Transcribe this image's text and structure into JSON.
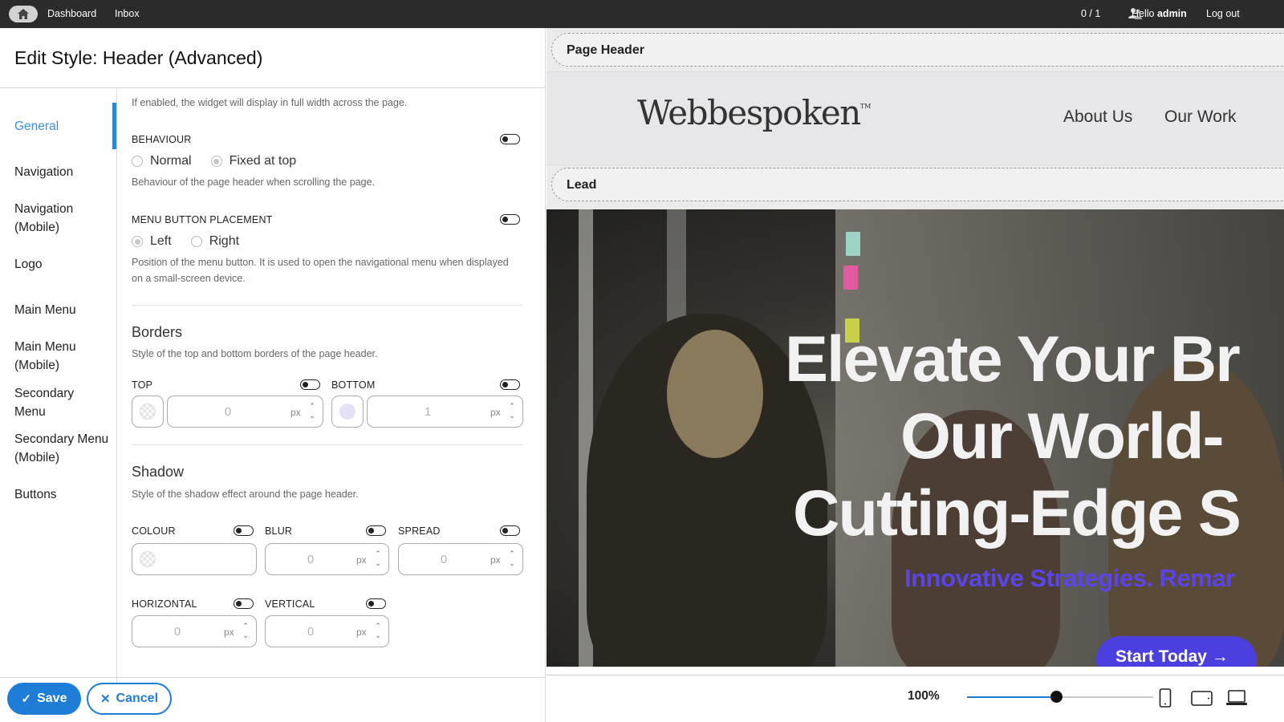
{
  "topbar": {
    "home_icon": "home-icon",
    "dashboard": "Dashboard",
    "inbox": "Inbox",
    "user_count": "0 / 1",
    "users_icon": "users-icon",
    "hello": "Hello",
    "username": "admin",
    "logout": "Log out"
  },
  "editor": {
    "title": "Edit Style: Header (Advanced)",
    "nav": [
      {
        "label": "General"
      },
      {
        "label": "Navigation"
      },
      {
        "label": "Navigation (Mobile)"
      },
      {
        "label": "Logo"
      },
      {
        "label": "Main Menu"
      },
      {
        "label": "Main Menu (Mobile)"
      },
      {
        "label": "Secondary Menu"
      },
      {
        "label": "Secondary Menu (Mobile)"
      },
      {
        "label": "Buttons"
      }
    ],
    "active_nav": "General",
    "full_width_desc": "If enabled, the widget will display in full width across the page.",
    "behaviour": {
      "label": "BEHAVIOUR",
      "options": [
        "Normal",
        "Fixed at top"
      ],
      "selected": "Fixed at top",
      "desc": "Behaviour of the page header when scrolling the page."
    },
    "menu_button": {
      "label": "MENU BUTTON PLACEMENT",
      "options": [
        "Left",
        "Right"
      ],
      "selected": "Left",
      "desc": "Position of the menu button. It is used to open the navigational menu when displayed on a small-screen device."
    },
    "borders": {
      "title": "Borders",
      "desc": "Style of the top and bottom borders of the page header.",
      "top_label": "TOP",
      "top_value": "0",
      "bottom_label": "BOTTOM",
      "bottom_value": "1",
      "unit": "px",
      "bottom_color": "#e3e2f7"
    },
    "shadow": {
      "title": "Shadow",
      "desc": "Style of the shadow effect around the page header.",
      "colour_label": "COLOUR",
      "blur_label": "BLUR",
      "blur_value": "0",
      "spread_label": "SPREAD",
      "spread_value": "0",
      "horizontal_label": "HORIZONTAL",
      "horizontal_value": "0",
      "vertical_label": "VERTICAL",
      "vertical_value": "0",
      "unit": "px"
    },
    "save": "Save",
    "cancel": "Cancel",
    "accent": "#1e7dd6"
  },
  "preview": {
    "page_header_label": "Page Header",
    "lead_label": "Lead",
    "logo_text": "Webbespoken",
    "logo_tm": "TM",
    "menu": [
      "About Us",
      "Our Work"
    ],
    "hero_lines": [
      "Elevate Your Br",
      "Our World-",
      "Cutting-Edge S"
    ],
    "hero_sub": "Innovative Strategies. Remar",
    "cta": "Start Today →",
    "cta_color": "#4b3fe0",
    "sub_color": "#5b45e8",
    "zoom": "100%",
    "zoom_fraction": 0.48,
    "devices": [
      "phone-icon",
      "tablet-icon",
      "laptop-icon"
    ]
  }
}
